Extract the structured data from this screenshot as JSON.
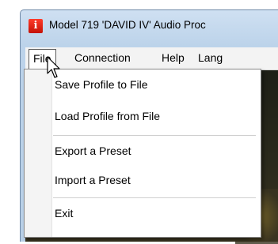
{
  "window": {
    "title": "Model 719 'DAVID IV' Audio Proc",
    "icon": "app-icon",
    "icon_glyph": "i",
    "icon_color": "#e0281a"
  },
  "menubar": {
    "items": [
      {
        "label": "File"
      },
      {
        "label": "Connection"
      },
      {
        "label": "Help"
      },
      {
        "label": "Lang"
      }
    ]
  },
  "file_menu": {
    "items": [
      {
        "label": "Save Profile to File"
      },
      {
        "label": "Load Profile from File"
      },
      {
        "label": "Export a Preset"
      },
      {
        "label": "Import a Preset"
      },
      {
        "label": "Exit"
      }
    ]
  },
  "cursor": {
    "icon": "mouse-pointer-icon"
  }
}
